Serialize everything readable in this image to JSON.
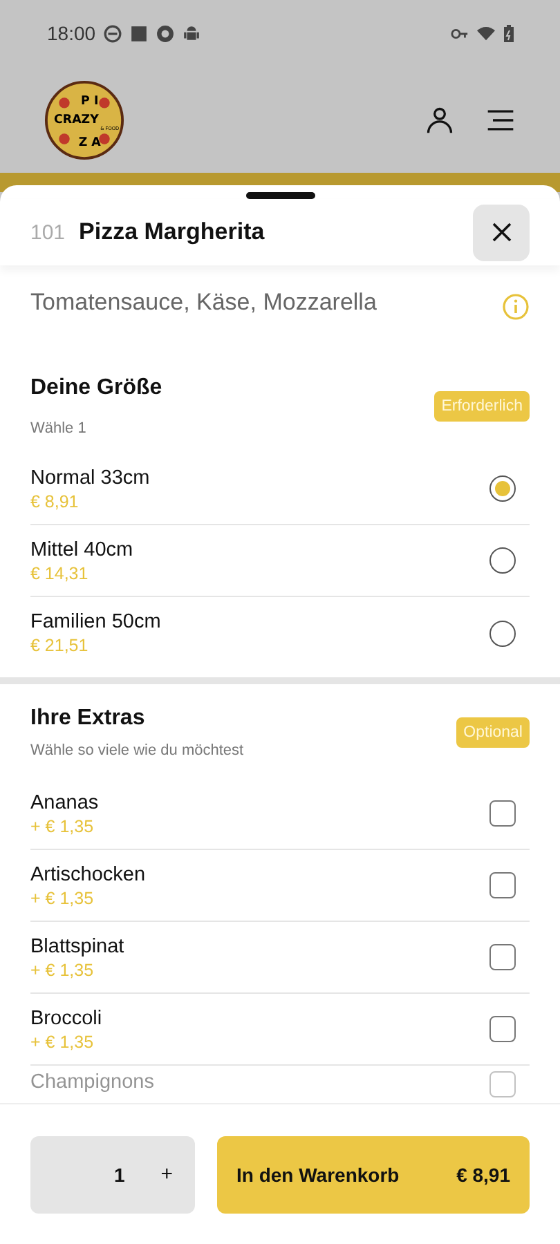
{
  "status_bar": {
    "time": "18:00"
  },
  "header": {
    "logo": {
      "top": "P I",
      "middle": "CRAZY",
      "bottom": "Z A",
      "small": "& FOOD"
    }
  },
  "product": {
    "number": "101",
    "name": "Pizza Margherita",
    "description": "Tomatensauce, Käse, Mozzarella"
  },
  "sections": [
    {
      "title": "Deine Größe",
      "subtitle": "Wähle 1",
      "badge": "Erforderlich",
      "kind": "radio",
      "options": [
        {
          "name": "Normal 33cm",
          "price": "€ 8,91",
          "selected": true
        },
        {
          "name": "Mittel 40cm",
          "price": "€ 14,31",
          "selected": false
        },
        {
          "name": "Familien 50cm",
          "price": "€ 21,51",
          "selected": false
        }
      ]
    },
    {
      "title": "Ihre Extras",
      "subtitle": "Wähle so viele wie du möchtest",
      "badge": "Optional",
      "kind": "checkbox",
      "options": [
        {
          "name": "Ananas",
          "price": "+ € 1,35",
          "selected": false
        },
        {
          "name": "Artischocken",
          "price": "+ € 1,35",
          "selected": false
        },
        {
          "name": "Blattspinat",
          "price": "+ € 1,35",
          "selected": false
        },
        {
          "name": "Broccoli",
          "price": "+ € 1,35",
          "selected": false
        },
        {
          "name": "Champignons",
          "selected": false
        }
      ]
    }
  ],
  "footer": {
    "quantity": "1",
    "plus": "+",
    "add_label": "In den Warenkorb",
    "total": "€ 8,91"
  }
}
